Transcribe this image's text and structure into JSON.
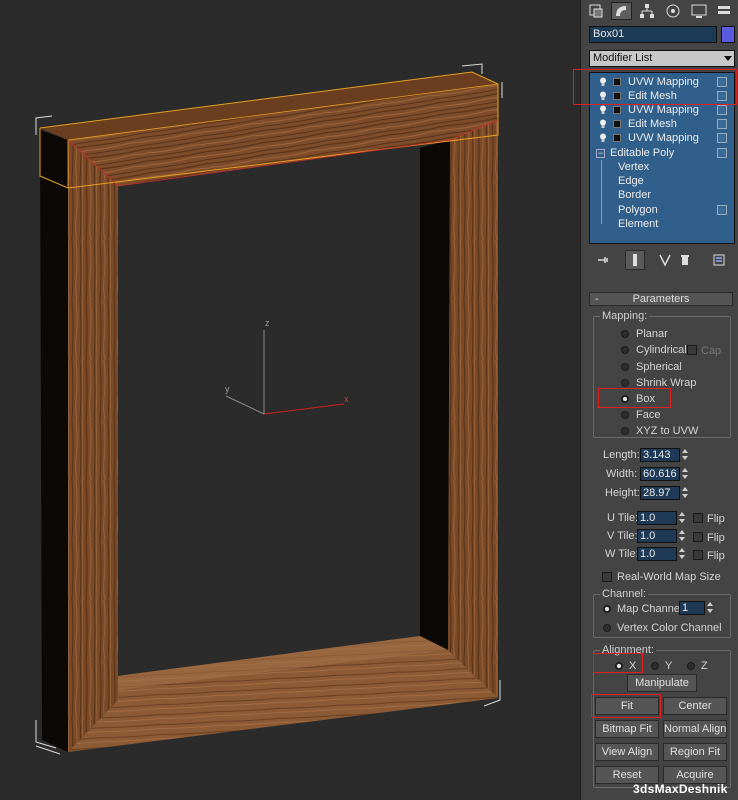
{
  "object": {
    "name": "Box01",
    "color": "#5a5ae0"
  },
  "modifier_list": {
    "label": "Modifier List"
  },
  "stack": {
    "items": [
      {
        "label": "UVW Mapping"
      },
      {
        "label": "Edit Mesh"
      },
      {
        "label": "UVW Mapping"
      },
      {
        "label": "Edit Mesh"
      },
      {
        "label": "UVW Mapping"
      },
      {
        "label": "Editable Poly"
      }
    ],
    "sub_items": [
      "Vertex",
      "Edge",
      "Border",
      "Polygon",
      "Element"
    ]
  },
  "tabs": [
    "create-icon",
    "modify-icon",
    "hierarchy-icon",
    "motion-icon",
    "display-icon",
    "utilities-icon"
  ],
  "viewport": {
    "axis_labels": {
      "x": "x",
      "y": "y",
      "z": "z"
    },
    "texture_colors": {
      "wood_light": "#8a5630",
      "wood_dark": "#5a3418",
      "selection": "#e8a020"
    }
  },
  "parameters": {
    "title": "Parameters",
    "collapse_symbol": "-",
    "mapping": {
      "title": "Mapping:",
      "options": [
        "Planar",
        "Cylindrical",
        "Spherical",
        "Shrink Wrap",
        "Box",
        "Face",
        "XYZ to UVW"
      ],
      "selected": "Box",
      "cap_label": "Cap"
    },
    "length": {
      "label": "Length:",
      "value": "3.143"
    },
    "width": {
      "label": "Width:",
      "value": "60.616"
    },
    "height": {
      "label": "Height:",
      "value": "28.97"
    },
    "u_tile": {
      "label": "U Tile:",
      "value": "1.0"
    },
    "v_tile": {
      "label": "V Tile:",
      "value": "1.0"
    },
    "w_tile": {
      "label": "W Tile:",
      "value": "1.0"
    },
    "flip_label": "Flip",
    "real_world": "Real-World Map Size",
    "channel": {
      "title": "Channel:",
      "map_channel": "Map Channel:",
      "map_channel_value": "1",
      "vertex_color": "Vertex Color Channel"
    },
    "alignment": {
      "title": "Alignment:",
      "axes": [
        "X",
        "Y",
        "Z"
      ],
      "selected": "X",
      "manipulate": "Manipulate",
      "fit": "Fit",
      "center": "Center",
      "bitmap_fit": "Bitmap Fit",
      "normal_align": "Normal Align",
      "view_align": "View Align",
      "region_fit": "Region Fit",
      "reset": "Reset",
      "acquire": "Acquire"
    }
  },
  "highlight_color": "#e02020",
  "watermark": "3dsMaxDeshnik"
}
